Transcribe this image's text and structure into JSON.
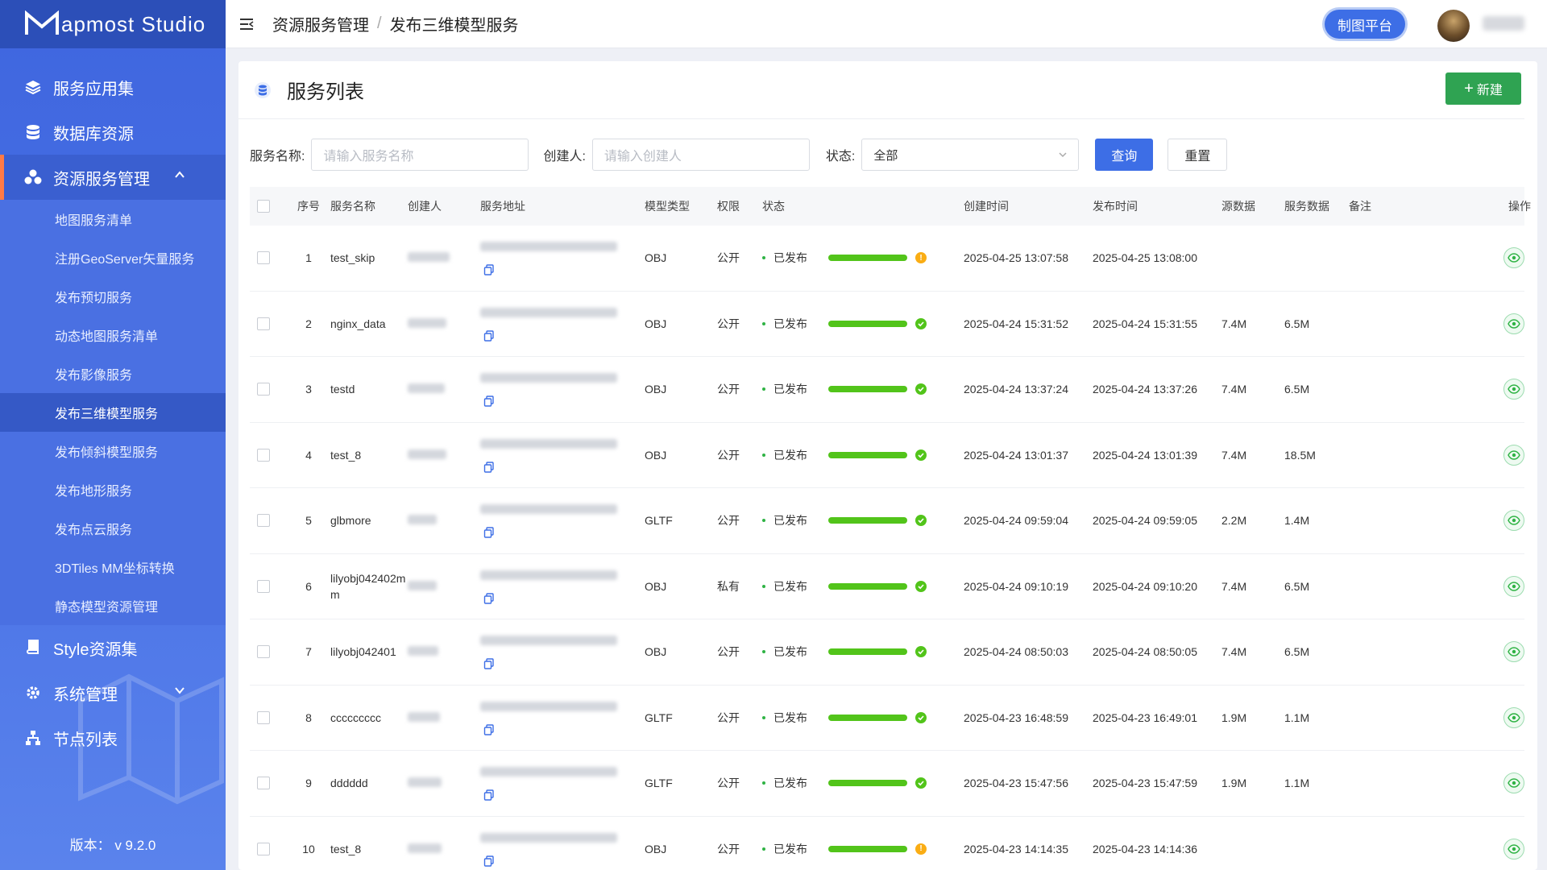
{
  "app": {
    "logo_text": "apmost Studio",
    "version": "版本： v 9.2.0"
  },
  "sidebar": {
    "items": [
      {
        "label": "服务应用集",
        "icon": "layers-icon"
      },
      {
        "label": "数据库资源",
        "icon": "database-icon"
      },
      {
        "label": "资源服务管理",
        "icon": "cubes-icon",
        "expanded": true
      },
      {
        "label": "Style资源集",
        "icon": "book-icon"
      },
      {
        "label": "系统管理",
        "icon": "gear-icon"
      },
      {
        "label": "节点列表",
        "icon": "sitemap-icon"
      }
    ],
    "subitems": [
      "地图服务清单",
      "注册GeoServer矢量服务",
      "发布预切服务",
      "动态地图服务清单",
      "发布影像服务",
      "发布三维模型服务",
      "发布倾斜模型服务",
      "发布地形服务",
      "发布点云服务",
      "3DTiles MM坐标转换",
      "静态模型资源管理"
    ],
    "active_sub": "发布三维模型服务"
  },
  "header": {
    "breadcrumb": [
      "资源服务管理",
      "发布三维模型服务"
    ],
    "map_button": "制图平台"
  },
  "page": {
    "title": "服务列表",
    "new_button": "新建"
  },
  "filters": {
    "name_label": "服务名称:",
    "name_placeholder": "请输入服务名称",
    "creator_label": "创建人:",
    "creator_placeholder": "请输入创建人",
    "status_label": "状态:",
    "status_value": "全部",
    "query_button": "查询",
    "reset_button": "重置"
  },
  "table": {
    "columns": [
      "序号",
      "服务名称",
      "创建人",
      "服务地址",
      "模型类型",
      "权限",
      "状态",
      "创建时间",
      "发布时间",
      "源数据",
      "服务数据",
      "备注",
      "操作"
    ],
    "rows": [
      {
        "no": "1",
        "name": "test_skip",
        "type": "OBJ",
        "perm": "公开",
        "status": "已发布",
        "state": "warn",
        "created": "2025-04-25 13:07:58",
        "published": "2025-04-25 13:08:00",
        "src": "",
        "svc": ""
      },
      {
        "no": "2",
        "name": "nginx_data",
        "type": "OBJ",
        "perm": "公开",
        "status": "已发布",
        "state": "ok",
        "created": "2025-04-24 15:31:52",
        "published": "2025-04-24 15:31:55",
        "src": "7.4M",
        "svc": "6.5M"
      },
      {
        "no": "3",
        "name": "testd",
        "type": "OBJ",
        "perm": "公开",
        "status": "已发布",
        "state": "ok",
        "created": "2025-04-24 13:37:24",
        "published": "2025-04-24 13:37:26",
        "src": "7.4M",
        "svc": "6.5M"
      },
      {
        "no": "4",
        "name": "test_8",
        "type": "OBJ",
        "perm": "公开",
        "status": "已发布",
        "state": "ok",
        "created": "2025-04-24 13:01:37",
        "published": "2025-04-24 13:01:39",
        "src": "7.4M",
        "svc": "18.5M"
      },
      {
        "no": "5",
        "name": "glbmore",
        "type": "GLTF",
        "perm": "公开",
        "status": "已发布",
        "state": "ok",
        "created": "2025-04-24 09:59:04",
        "published": "2025-04-24 09:59:05",
        "src": "2.2M",
        "svc": "1.4M"
      },
      {
        "no": "6",
        "name": "lilyobj042402mm",
        "type": "OBJ",
        "perm": "私有",
        "status": "已发布",
        "state": "ok",
        "created": "2025-04-24 09:10:19",
        "published": "2025-04-24 09:10:20",
        "src": "7.4M",
        "svc": "6.5M"
      },
      {
        "no": "7",
        "name": "lilyobj042401",
        "type": "OBJ",
        "perm": "公开",
        "status": "已发布",
        "state": "ok",
        "created": "2025-04-24 08:50:03",
        "published": "2025-04-24 08:50:05",
        "src": "7.4M",
        "svc": "6.5M"
      },
      {
        "no": "8",
        "name": "ccccccccc",
        "type": "GLTF",
        "perm": "公开",
        "status": "已发布",
        "state": "ok",
        "created": "2025-04-23 16:48:59",
        "published": "2025-04-23 16:49:01",
        "src": "1.9M",
        "svc": "1.1M"
      },
      {
        "no": "9",
        "name": "dddddd",
        "type": "GLTF",
        "perm": "公开",
        "status": "已发布",
        "state": "ok",
        "created": "2025-04-23 15:47:56",
        "published": "2025-04-23 15:47:59",
        "src": "1.9M",
        "svc": "1.1M"
      },
      {
        "no": "10",
        "name": "test_8",
        "type": "OBJ",
        "perm": "公开",
        "status": "已发布",
        "state": "warn",
        "created": "2025-04-23 14:14:35",
        "published": "2025-04-23 14:14:36",
        "src": "",
        "svc": ""
      }
    ]
  },
  "colors": {
    "sidebar": "#4a72e6",
    "primary": "#3d6ee6",
    "success": "#52c41a",
    "warn": "#faad14",
    "new": "#2fa352",
    "danger": "#f5222d"
  }
}
